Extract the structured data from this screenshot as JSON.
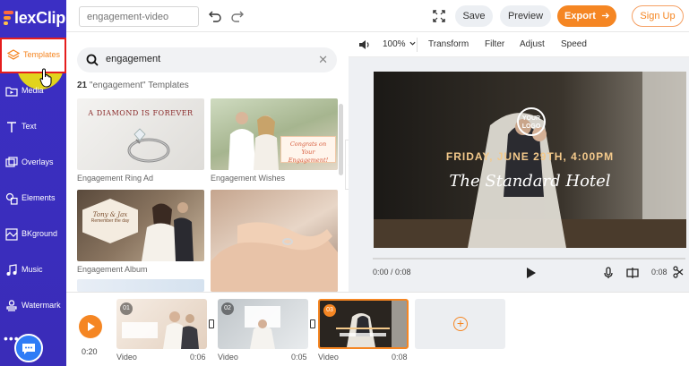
{
  "app": {
    "logo_text": "lexClip",
    "logo_letter": "F",
    "brand_color": "#3b2fc4",
    "accent_color": "#f58623"
  },
  "sidebar": {
    "items": [
      {
        "id": "templates",
        "label": "Templates",
        "icon": "layers-icon",
        "active": true
      },
      {
        "id": "media",
        "label": "Media",
        "icon": "folder-icon"
      },
      {
        "id": "text",
        "label": "Text",
        "icon": "text-icon"
      },
      {
        "id": "overlays",
        "label": "Overlays",
        "icon": "overlay-icon"
      },
      {
        "id": "elements",
        "label": "Elements",
        "icon": "elements-icon"
      },
      {
        "id": "bkground",
        "label": "BKground",
        "icon": "background-icon"
      },
      {
        "id": "music",
        "label": "Music",
        "icon": "music-icon"
      },
      {
        "id": "watermark",
        "label": "Watermark",
        "icon": "watermark-icon"
      }
    ],
    "more": "•••",
    "chat_icon": "chat-bubble-icon"
  },
  "topbar": {
    "project_placeholder": "engagement-video",
    "save_label": "Save",
    "preview_label": "Preview",
    "export_label": "Export",
    "signup_label": "Sign Up"
  },
  "templates_panel": {
    "search_value": "engagement",
    "count_number": "21",
    "count_text": "\"engagement\" Templates",
    "thumbnails": [
      {
        "label": "Engagement Ring Ad",
        "caption": "A DIAMOND IS FOREVER"
      },
      {
        "label": "Engagement Wishes",
        "caption": "Congrats on Your Engagement!"
      },
      {
        "label": "Engagement Album",
        "caption": "Tony & Jax",
        "subcaption": "Remember the day"
      },
      {
        "label": "",
        "caption": ""
      }
    ]
  },
  "edit_toolbar": {
    "zoom": "100%",
    "tools": [
      "Transform",
      "Filter",
      "Adjust",
      "Speed"
    ]
  },
  "preview": {
    "logo_text": "YOUR LOGO",
    "date_text": "FRIDAY, JUNE 29TH, 4:00PM",
    "venue_text": "The Standard Hotel",
    "time_current": "0:00 / 0:08",
    "time_end": "0:08"
  },
  "timeline": {
    "time": "0:20",
    "clips": [
      {
        "num": "01",
        "type": "Video",
        "duration": "0:06"
      },
      {
        "num": "02",
        "type": "Video",
        "duration": "0:05"
      },
      {
        "num": "03",
        "type": "Video",
        "duration": "0:08",
        "selected": true
      }
    ]
  }
}
